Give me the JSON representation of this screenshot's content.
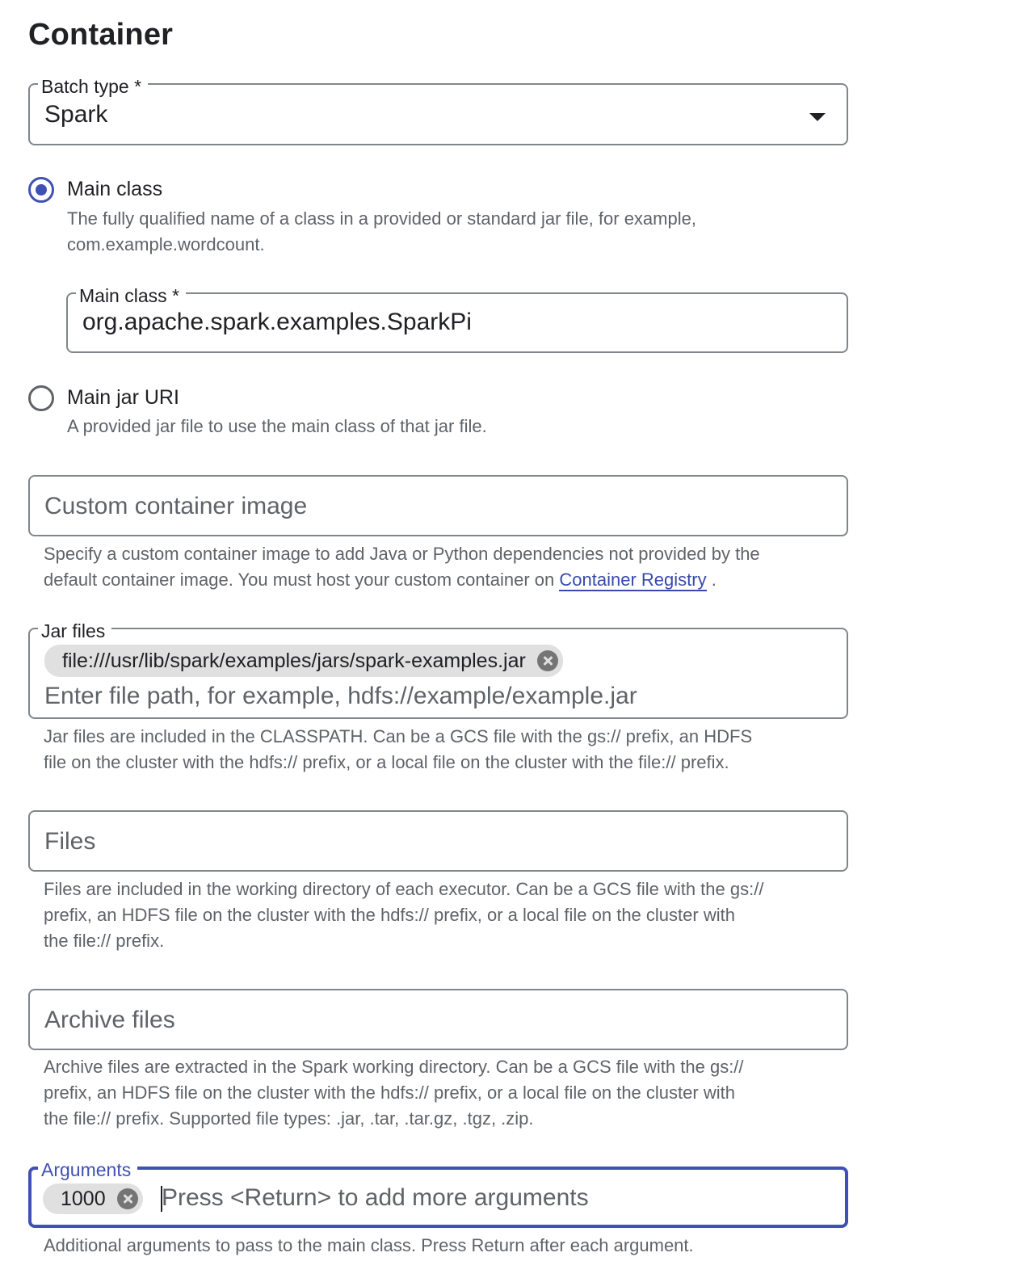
{
  "page": {
    "title": "Container"
  },
  "batch_type": {
    "label": "Batch type *",
    "value": "Spark"
  },
  "main_class_option": {
    "label": "Main class",
    "description_line1": "The fully qualified name of a class in a provided or standard jar file, for example,",
    "description_line2": "com.example.wordcount.",
    "checked": true
  },
  "main_class_field": {
    "label": "Main class *",
    "value": "org.apache.spark.examples.SparkPi"
  },
  "main_jar_option": {
    "label": "Main jar URI",
    "description": "A provided jar file to use the main class of that jar file.",
    "checked": false
  },
  "custom_image": {
    "placeholder": "Custom container image",
    "helper_line1": "Specify a custom container image to add Java or Python dependencies not provided by the",
    "helper_line2_prefix": "default container image. You must host your custom container on",
    "helper_link": "Container Registry",
    "helper_suffix": "."
  },
  "jar_files": {
    "label": "Jar files",
    "chip": "file:///usr/lib/spark/examples/jars/spark-examples.jar",
    "placeholder": "Enter file path, for example, hdfs://example/example.jar",
    "helper_line1": "Jar files are included in the CLASSPATH. Can be a GCS file with the gs:// prefix, an HDFS",
    "helper_line2": "file on the cluster with the hdfs:// prefix, or a local file on the cluster with the file:// prefix."
  },
  "files": {
    "placeholder": "Files",
    "helper_line1": "Files are included in the working directory of each executor. Can be a GCS file with the gs://",
    "helper_line2": "prefix, an HDFS file on the cluster with the hdfs:// prefix, or a local file on the cluster with",
    "helper_line3": "the file:// prefix."
  },
  "archive_files": {
    "placeholder": "Archive files",
    "helper_line1": "Archive files are extracted in the Spark working directory. Can be a GCS file with the gs://",
    "helper_line2": "prefix, an HDFS file on the cluster with the hdfs:// prefix, or a local file on the cluster with",
    "helper_line3": "the file:// prefix. Supported file types: .jar, .tar, .tar.gz, .tgz, .zip."
  },
  "arguments": {
    "label": "Arguments",
    "chip": "1000",
    "placeholder": "Press <Return> to add more arguments",
    "helper": "Additional arguments to pass to the main class. Press Return after each argument."
  },
  "colors": {
    "accent": "#3f51b5",
    "link": "#3949ab",
    "border": "#80868b",
    "helper_text": "#5f6368",
    "chip_bg": "#e0e0e0"
  },
  "icons": {
    "dropdown": "arrow-drop-down-icon",
    "chip_remove": "cancel-icon"
  }
}
